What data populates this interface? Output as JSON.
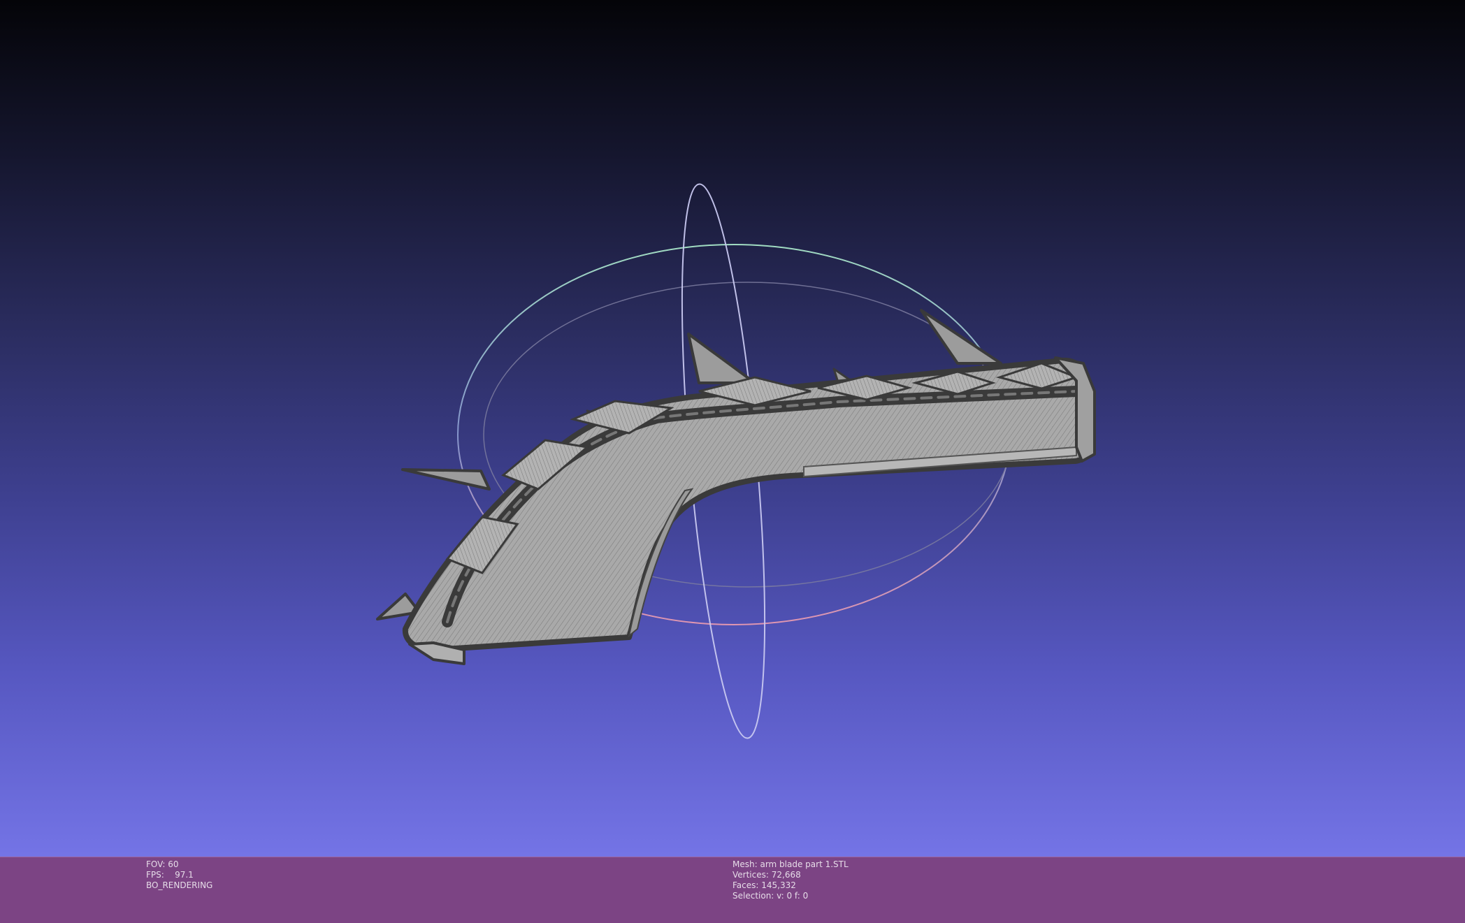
{
  "viewer": {
    "background_top": "#040408",
    "background_bottom": "#7474e6",
    "status_bar_color": "#7c4484"
  },
  "trackball": {
    "ring_horizontal_color": "#a8e6c8",
    "ring_vertical_color": "#c8c8f0",
    "ring_lower_color": "#e89ab0"
  },
  "mesh": {
    "color": "#a8a8a8",
    "edge_color": "#3a3a3a"
  },
  "status_left": {
    "fov_label": "FOV:",
    "fov_value": "60",
    "fps_label": "FPS:",
    "fps_value": "97.1",
    "render_mode": "BO_RENDERING"
  },
  "status_right": {
    "mesh_label": "Mesh:",
    "mesh_name": "arm blade part 1.STL",
    "vertices_label": "Vertices:",
    "vertices_value": "72,668",
    "faces_label": "Faces:",
    "faces_value": "145,332",
    "selection_label": "Selection:",
    "selection_value": "v: 0 f: 0"
  }
}
